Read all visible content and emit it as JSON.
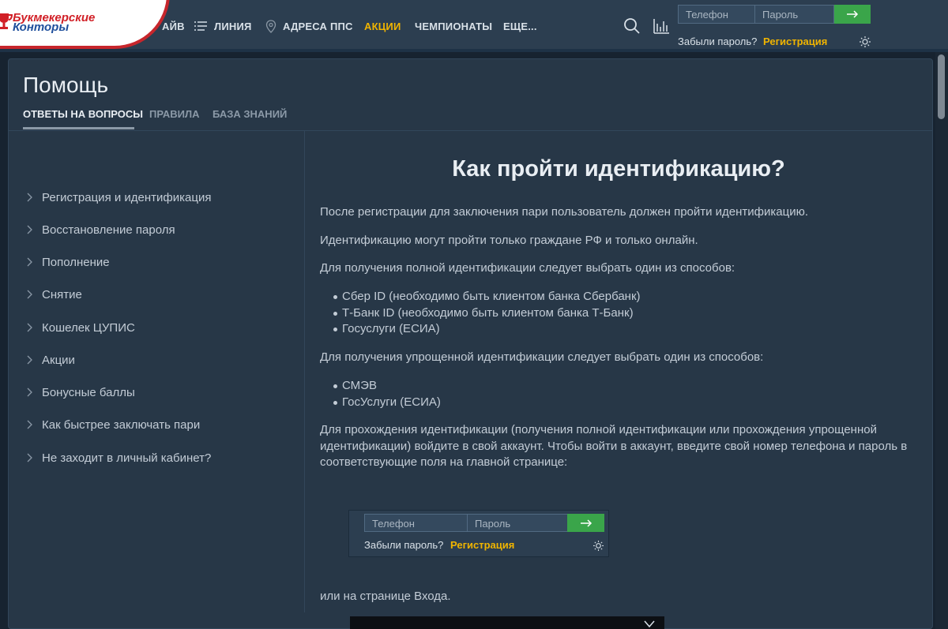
{
  "header": {
    "logo": {
      "line1": "Букмекерские",
      "line2": "Конторы"
    },
    "nav": [
      {
        "label": "АЙВ",
        "icon": "",
        "active": false
      },
      {
        "label": "ЛИНИЯ",
        "icon": "list-icon",
        "active": false
      },
      {
        "label": "АДРЕСА ППС",
        "icon": "map-pin-icon",
        "active": false
      },
      {
        "label": "АКЦИИ",
        "icon": "",
        "active": true
      },
      {
        "label": "ЧЕМПИОНАТЫ",
        "icon": "",
        "active": false
      },
      {
        "label": "ЕЩЕ...",
        "icon": "",
        "active": false
      }
    ],
    "tools": [
      "search-icon",
      "stats-chart-icon"
    ],
    "login": {
      "phone_placeholder": "Телефон",
      "password_placeholder": "Пароль",
      "submit_icon": "arrow-right-icon",
      "forgot": "Забыли пароль?",
      "register": "Регистрация",
      "theme_icon": "sun-icon"
    },
    "accent_color": "#f0b400",
    "button_color": "#3aa54a"
  },
  "page": {
    "title": "Помощь",
    "tabs": [
      {
        "label": "ОТВЕТЫ НА ВОПРОСЫ",
        "active": true
      },
      {
        "label": "ПРАВИЛА",
        "active": false
      },
      {
        "label": "БАЗА ЗНАНИЙ",
        "active": false
      }
    ]
  },
  "sidebar": {
    "items": [
      {
        "label": "Регистрация и идентификация"
      },
      {
        "label": "Восстановление пароля"
      },
      {
        "label": "Пополнение"
      },
      {
        "label": "Снятие"
      },
      {
        "label": "Кошелек ЦУПИС"
      },
      {
        "label": "Акции"
      },
      {
        "label": "Бонусные баллы"
      },
      {
        "label": "Как быстрее заключать пари"
      },
      {
        "label": "Не заходит в личный кабинет?"
      }
    ]
  },
  "article": {
    "title": "Как пройти идентификацию?",
    "p1": "После регистрации для заключения пари пользователь должен пройти идентификацию.",
    "p2": "Идентификацию могут пройти только граждане РФ и только онлайн.",
    "p3": "Для получения полной идентификации следует выбрать один из способов:",
    "list_full": [
      "Сбер ID (необходимо быть клиентом банка Сбербанк)",
      "Т-Банк ID (необходимо быть клиентом банка Т-Банк)",
      "Госуслуги (ЕСИА)"
    ],
    "p4": "Для получения упрощенной идентификации следует выбрать один из способов:",
    "list_simple": [
      "СМЭВ",
      "ГосУслуги (ЕСИА)"
    ],
    "p5": "Для прохождения идентификации (получения полной идентификации или прохождения упрощенной идентификации) войдите в свой аккаунт. Чтобы войти в аккаунт, введите свой номер телефона и пароль в соответствующие поля на главной странице:",
    "embed": {
      "phone_placeholder": "Телефон",
      "password_placeholder": "Пароль",
      "forgot": "Забыли пароль?",
      "register": "Регистрация"
    },
    "p6": "или на странице Входа."
  }
}
